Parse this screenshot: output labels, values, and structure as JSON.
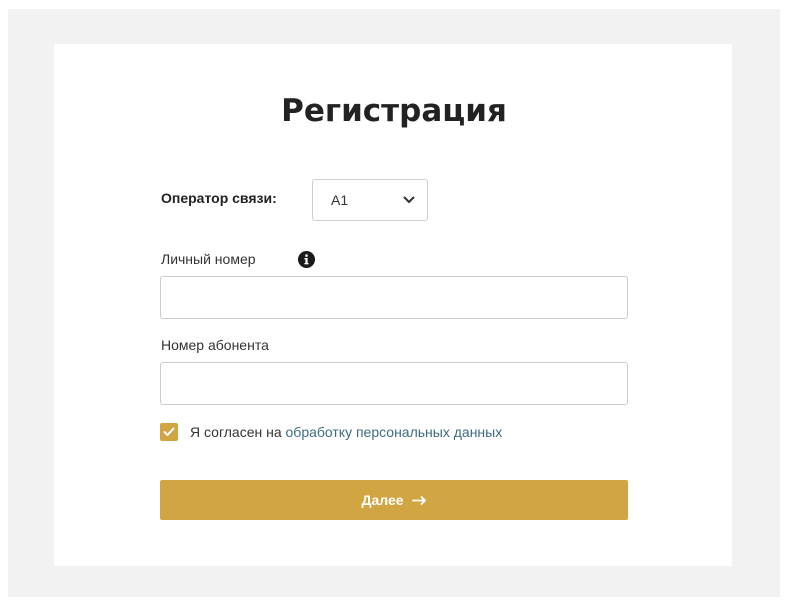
{
  "form": {
    "title": "Регистрация",
    "operator": {
      "label": "Оператор связи:",
      "selected": "A1"
    },
    "personal_number": {
      "label": "Личный номер",
      "value": "",
      "info_icon": "info-icon"
    },
    "subscriber_number": {
      "label": "Номер абонента",
      "value": ""
    },
    "consent": {
      "checked": true,
      "text": "Я согласен на",
      "link_text": "обработку персональных данных"
    },
    "submit": {
      "label": "Далее",
      "icon": "arrow-right-icon"
    }
  },
  "colors": {
    "accent": "#d1a541",
    "link": "#3d6b7f",
    "background": "#f2f2f2",
    "card": "#ffffff"
  }
}
